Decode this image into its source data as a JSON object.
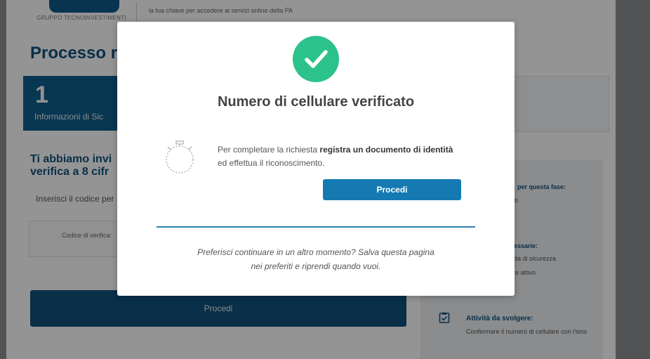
{
  "header": {
    "logo_text": "GRUPPO TECNOINVESTIMENTI",
    "tagline": "la tua chiave per accedere ai servizi online della PA"
  },
  "page": {
    "title": "Processo r",
    "step": {
      "number": "1",
      "label": "Informazioni di Sic"
    },
    "sent_title_line1": "Ti abbiamo invi",
    "sent_title_line2": "verifica a 8 cifr",
    "enter_code": "Inserisci il codice per",
    "code_label": "Codice di verifica:",
    "proceed_label": "Procedi"
  },
  "info_panel": {
    "phase_title_fragment": "per questa fase:",
    "phase_text_fragment": "o",
    "requirements_title_fragment": "ecessarie:",
    "requirement_1_fragment": "anda di sicurezza",
    "requirement_2_fragment": "llare attivo",
    "task_title": "Attività da svolgere:",
    "task_text": "Confermare il numero di cellulare con l'sms"
  },
  "modal": {
    "title": "Numero di cellulare verificato",
    "message_prefix": "Per completare la richiesta ",
    "message_bold": "registra un documento di identità",
    "message_suffix": "ed effettua il riconoscimento.",
    "proceed_label": "Procedi",
    "later_line1": "Preferisci continuare in un altro momento?  Salva questa pagina",
    "later_line2": "nei preferiti e riprendi quando vuoi."
  },
  "colors": {
    "brand_blue": "#11527e",
    "button_blue": "#157ab2",
    "success_green": "#2cc28c"
  },
  "icons": {
    "success": "check-icon",
    "timer": "stopwatch-icon",
    "task": "clipboard-check-icon"
  }
}
